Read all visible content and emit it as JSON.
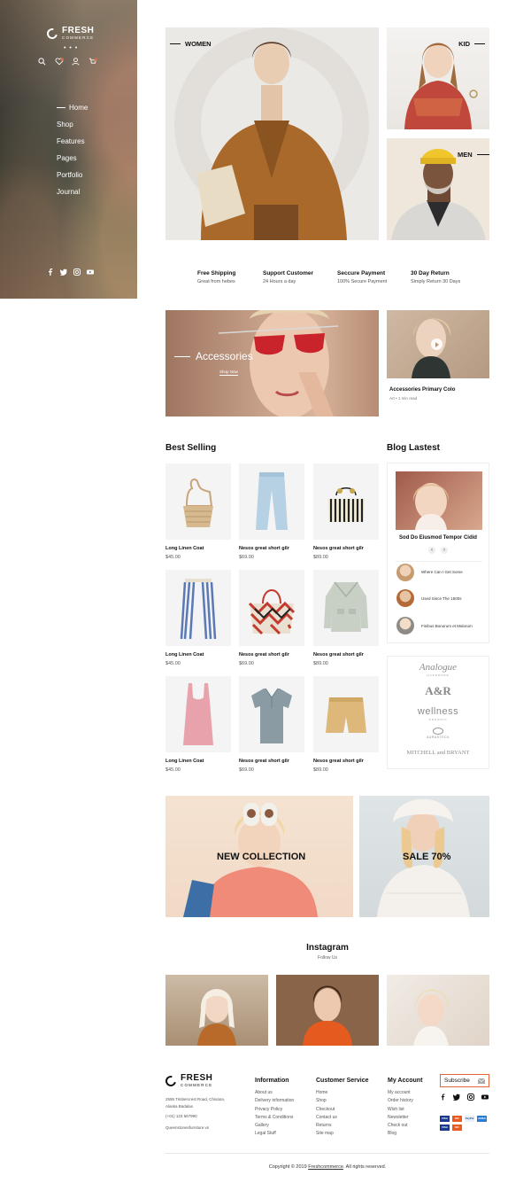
{
  "sidebar": {
    "logo": {
      "word": "FRESH",
      "sub": "COMMERCE"
    },
    "dots": "• • •",
    "menu": [
      {
        "label": "Home"
      },
      {
        "label": "Shop"
      },
      {
        "label": "Features"
      },
      {
        "label": "Pages"
      },
      {
        "label": "Portfolio"
      },
      {
        "label": "Journal"
      }
    ],
    "cart_count": "0",
    "wishlist_count": "0"
  },
  "hero": {
    "women_label": "WOMEN",
    "kid_label": "KID",
    "men_label": "MEN"
  },
  "features": [
    {
      "title": "Free Shipping",
      "sub": "Great from hebes"
    },
    {
      "title": "Support Customer",
      "sub": "24 Hours a day"
    },
    {
      "title": "Seccure Payment",
      "sub": "100% Secure Payment"
    },
    {
      "title": "30 Day Return",
      "sub": "Simply Return 30 Days"
    }
  ],
  "promo": {
    "accessories_title": "Accessories",
    "accessories_cta": "Shop Now",
    "video_title": "Accessories Primary Colo",
    "video_meta": "Art • 1 min read"
  },
  "best_selling": {
    "title": "Best Selling",
    "products": [
      {
        "name": "Long Linen Coat",
        "price": "$45.00"
      },
      {
        "name": "Nesos great short gilr",
        "price": "$69.00"
      },
      {
        "name": "Nesos great short gilr",
        "price": "$89.00"
      },
      {
        "name": "Long Linen Coat",
        "price": "$45.00"
      },
      {
        "name": "Nesos great short gilr",
        "price": "$69.00"
      },
      {
        "name": "Nesos great short gilr",
        "price": "$89.00"
      },
      {
        "name": "Long Linen Coat",
        "price": "$45.00"
      },
      {
        "name": "Nesos great short gilr",
        "price": "$69.00"
      },
      {
        "name": "Nesos great short gilr",
        "price": "$89.00"
      }
    ]
  },
  "blog": {
    "title": "Blog Lastest",
    "feature_title": "Sod Do Eiusmod Tempor Cidid",
    "prev": "‹",
    "next": "›",
    "posts": [
      {
        "title": "Where Can I Get Some"
      },
      {
        "title": "Used Since The 1500s"
      },
      {
        "title": "Finibus Bonorum et Malorum"
      }
    ],
    "brands": [
      {
        "name": "Analogue",
        "sub": "HANDMADE"
      },
      {
        "name": "A&R",
        "sub": ""
      },
      {
        "name": "wellness",
        "sub": "ORGANIC"
      },
      {
        "name": "AURASTECK",
        "sub": ""
      },
      {
        "name": "MITCHELL and BRYANT",
        "sub": ""
      }
    ]
  },
  "banners": {
    "new_collection": "NEW COLLECTION",
    "sale": "SALE 70%"
  },
  "instagram": {
    "title": "Instagram",
    "sub": "Follow Us"
  },
  "footer": {
    "logo": {
      "word": "FRESH",
      "sub": "COMMERCE"
    },
    "address": "2595 Timbercrest Road, Chisana, Alaska Badalas",
    "phone": "(+01) 123 567990",
    "email": "Queenstonesfurniture.vn",
    "information": {
      "title": "Information",
      "links": [
        "About us",
        "Delivery information",
        "Privacy Policy",
        "Terms & Conditions",
        "Gallery",
        "Legal Stuff"
      ]
    },
    "customer_service": {
      "title": "Customer Service",
      "links": [
        "Home",
        "Shop",
        "Checkout",
        "Contact us",
        "Returns",
        "Site map"
      ]
    },
    "my_account": {
      "title": "My Account",
      "links": [
        "My account",
        "Order history",
        "Wish list",
        "Newsletter",
        "Check out",
        "Blog"
      ]
    },
    "subscribe_label": "Subscribe",
    "payments": [
      "VISA",
      "MC",
      "PayPal",
      "AMEX",
      "VISA",
      "MC"
    ],
    "copyright_prefix": "Copyright © 2019",
    "copyright_link": "Freshcommerce",
    "copyright_suffix": ". All rights reserved."
  },
  "colors": {
    "accent": "#e2683c",
    "text": "#111111",
    "muted": "#555555"
  }
}
